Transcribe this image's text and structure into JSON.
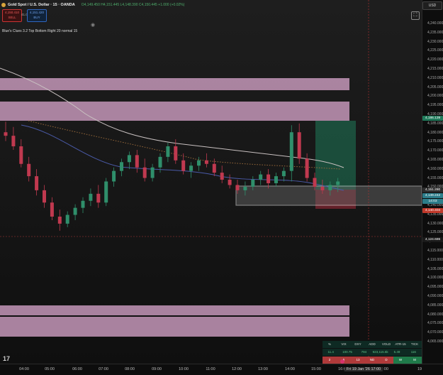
{
  "header": {
    "symbol": "Gold Spot / U.S. Dollar · 15 · OANDA",
    "ohlc": "O4,149.450 H4,151.445 L4,148.390 C4,150.445 +1.000 (+0.02%)",
    "sell_price": "4,150.410",
    "sell_label": "SELL",
    "buy_price": "4,151.420",
    "buy_label": "BUY",
    "spread": "41.0",
    "currency": "USD"
  },
  "indicator": {
    "label": "Blue's Clues 3.2 Top Bottom Right 20 normal 15"
  },
  "price_axis": {
    "ticks": [
      "4,240.000",
      "4,235.000",
      "4,230.000",
      "4,225.000",
      "4,220.000",
      "4,215.000",
      "4,210.000",
      "4,205.000",
      "4,200.000",
      "4,195.000",
      "4,190.000",
      "4,185.000",
      "4,180.000",
      "4,175.000",
      "4,170.000",
      "4,165.000",
      "4,160.000",
      "4,155.000",
      "4,150.000",
      "4,145.000",
      "4,140.000",
      "4,135.000",
      "4,130.000",
      "4,125.000",
      "4,120.000",
      "4,115.000",
      "4,110.000",
      "4,105.000",
      "4,100.000",
      "4,095.000",
      "4,090.000",
      "4,085.000",
      "4,080.000",
      "4,075.000",
      "4,070.000",
      "4,065.000"
    ],
    "tags": [
      {
        "text": "4,186.139",
        "color": "#1f7a5a"
      },
      {
        "text": "4,151.280",
        "color": "#2c2c2c"
      },
      {
        "text": "4,149.242",
        "color": "#2c7d8a"
      },
      {
        "text": "14:03",
        "color": "#2c7d8a"
      },
      {
        "text": "4,140.404",
        "color": "#c0392b"
      },
      {
        "text": "4,124.686",
        "color": "#1a1a1a"
      }
    ]
  },
  "time_axis": {
    "labels": [
      "04:00",
      "05:00",
      "06:00",
      "07:00",
      "08:00",
      "09:00",
      "10:00",
      "11:00",
      "12:00",
      "13:00",
      "14:00",
      "15:00",
      "16:00",
      "17:00",
      "19"
    ],
    "current": "Fri 19 Jan '26   17:00"
  },
  "table": {
    "headers": [
      "%",
      "VIX",
      "DXY",
      "ADD",
      "VOLD",
      "ATR-15",
      "TICK"
    ],
    "values": [
      "11.4",
      "100.75",
      "794",
      "923,115.5k",
      "5.49",
      "116"
    ],
    "statuses": [
      "2",
      "5",
      "13",
      "ND",
      "D",
      "W",
      "M"
    ]
  },
  "chart_data": {
    "type": "candlestick",
    "symbol": "XAUUSD",
    "interval": "15",
    "ylim": [
      4062,
      4243
    ],
    "candles": [
      [
        4178,
        4184,
        4173,
        4176
      ],
      [
        4176,
        4181,
        4168,
        4170
      ],
      [
        4170,
        4174,
        4158,
        4160
      ],
      [
        4160,
        4164,
        4150,
        4153
      ],
      [
        4153,
        4157,
        4142,
        4145
      ],
      [
        4145,
        4148,
        4135,
        4138
      ],
      [
        4138,
        4141,
        4128,
        4130
      ],
      [
        4130,
        4134,
        4122,
        4126
      ],
      [
        4126,
        4133,
        4124,
        4131
      ],
      [
        4131,
        4137,
        4128,
        4135
      ],
      [
        4135,
        4141,
        4132,
        4139
      ],
      [
        4139,
        4146,
        4136,
        4143
      ],
      [
        4143,
        4148,
        4135,
        4138
      ],
      [
        4138,
        4152,
        4136,
        4150
      ],
      [
        4150,
        4158,
        4147,
        4156
      ],
      [
        4156,
        4163,
        4153,
        4161
      ],
      [
        4161,
        4167,
        4157,
        4165
      ],
      [
        4165,
        4168,
        4155,
        4158
      ],
      [
        4158,
        4163,
        4150,
        4152
      ],
      [
        4152,
        4160,
        4150,
        4158
      ],
      [
        4158,
        4166,
        4155,
        4164
      ],
      [
        4164,
        4172,
        4161,
        4170
      ],
      [
        4170,
        4174,
        4160,
        4162
      ],
      [
        4162,
        4166,
        4154,
        4156
      ],
      [
        4156,
        4161,
        4152,
        4159
      ],
      [
        4159,
        4164,
        4156,
        4162
      ],
      [
        4162,
        4166,
        4158,
        4160
      ],
      [
        4160,
        4163,
        4153,
        4155
      ],
      [
        4155,
        4159,
        4149,
        4151
      ],
      [
        4151,
        4154,
        4146,
        4148
      ],
      [
        4148,
        4151,
        4143,
        4145
      ],
      [
        4145,
        4150,
        4142,
        4147
      ],
      [
        4147,
        4153,
        4145,
        4151
      ],
      [
        4151,
        4156,
        4148,
        4154
      ],
      [
        4154,
        4157,
        4146,
        4149
      ],
      [
        4149,
        4155,
        4147,
        4153
      ],
      [
        4153,
        4158,
        4150,
        4156
      ],
      [
        4156,
        4182,
        4150,
        4178
      ],
      [
        4178,
        4183,
        4160,
        4163
      ],
      [
        4163,
        4166,
        4150,
        4152
      ],
      [
        4152,
        4155,
        4145,
        4147
      ],
      [
        4147,
        4151,
        4143,
        4145
      ],
      [
        4145,
        4150,
        4142,
        4148
      ],
      [
        4148,
        4152,
        4144,
        4150
      ]
    ]
  }
}
